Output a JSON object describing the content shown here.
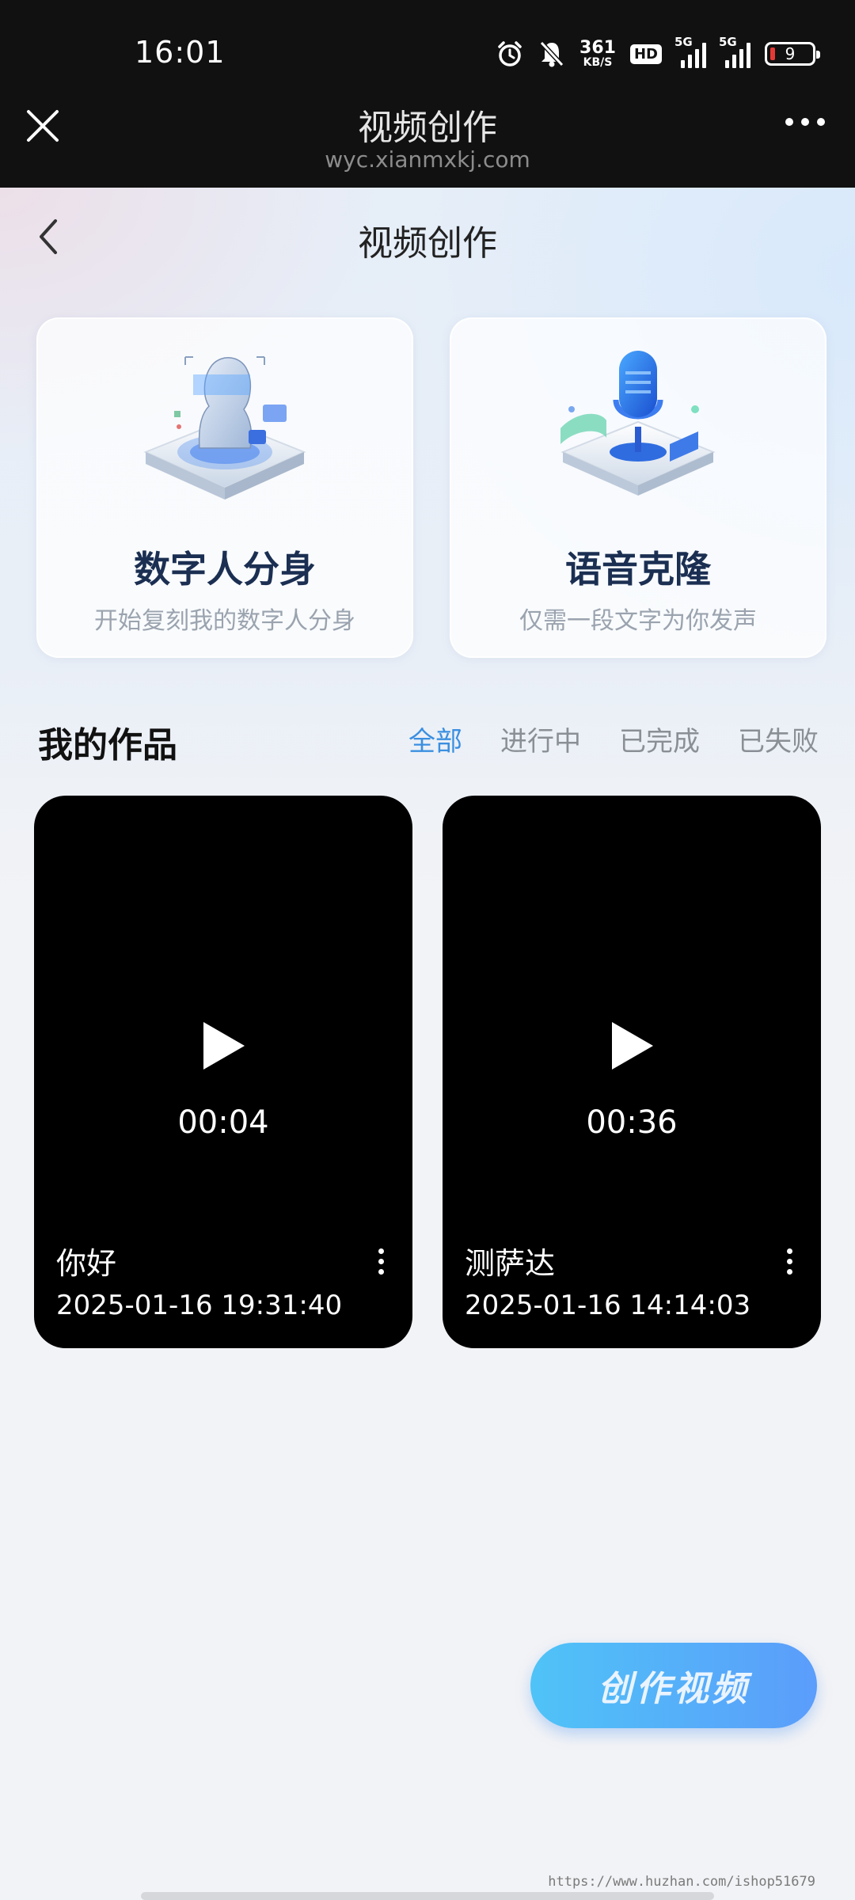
{
  "status_bar": {
    "time": "16:01",
    "net_speed_value": "361",
    "net_speed_unit": "KB/S",
    "hd_badge": "HD",
    "sim1_label": "5G",
    "sim2_label": "5G",
    "battery_level": "9",
    "icons": [
      "alarm-icon",
      "mute-icon",
      "signal-icon",
      "battery-icon"
    ]
  },
  "browser": {
    "title": "视频创作",
    "url": "wyc.xianmxkj.com"
  },
  "page": {
    "title": "视频创作",
    "features": [
      {
        "title": "数字人分身",
        "subtitle": "开始复刻我的数字人分身"
      },
      {
        "title": "语音克隆",
        "subtitle": "仅需一段文字为你发声"
      }
    ],
    "works_title": "我的作品",
    "tabs": [
      "全部",
      "进行中",
      "已完成",
      "已失败"
    ],
    "active_tab": "全部",
    "videos": [
      {
        "duration": "00:04",
        "name": "你好",
        "date": "2025-01-16 19:31:40"
      },
      {
        "duration": "00:36",
        "name": "测萨达",
        "date": "2025-01-16 14:14:03"
      }
    ],
    "create_button": "创作视频",
    "watermark": "https://www.huzhan.com/ishop51679"
  },
  "colors": {
    "accent": "#3b8fe0",
    "button_start": "#4fc3f7",
    "button_end": "#5b9dfb",
    "card_title": "#1b2f52"
  }
}
